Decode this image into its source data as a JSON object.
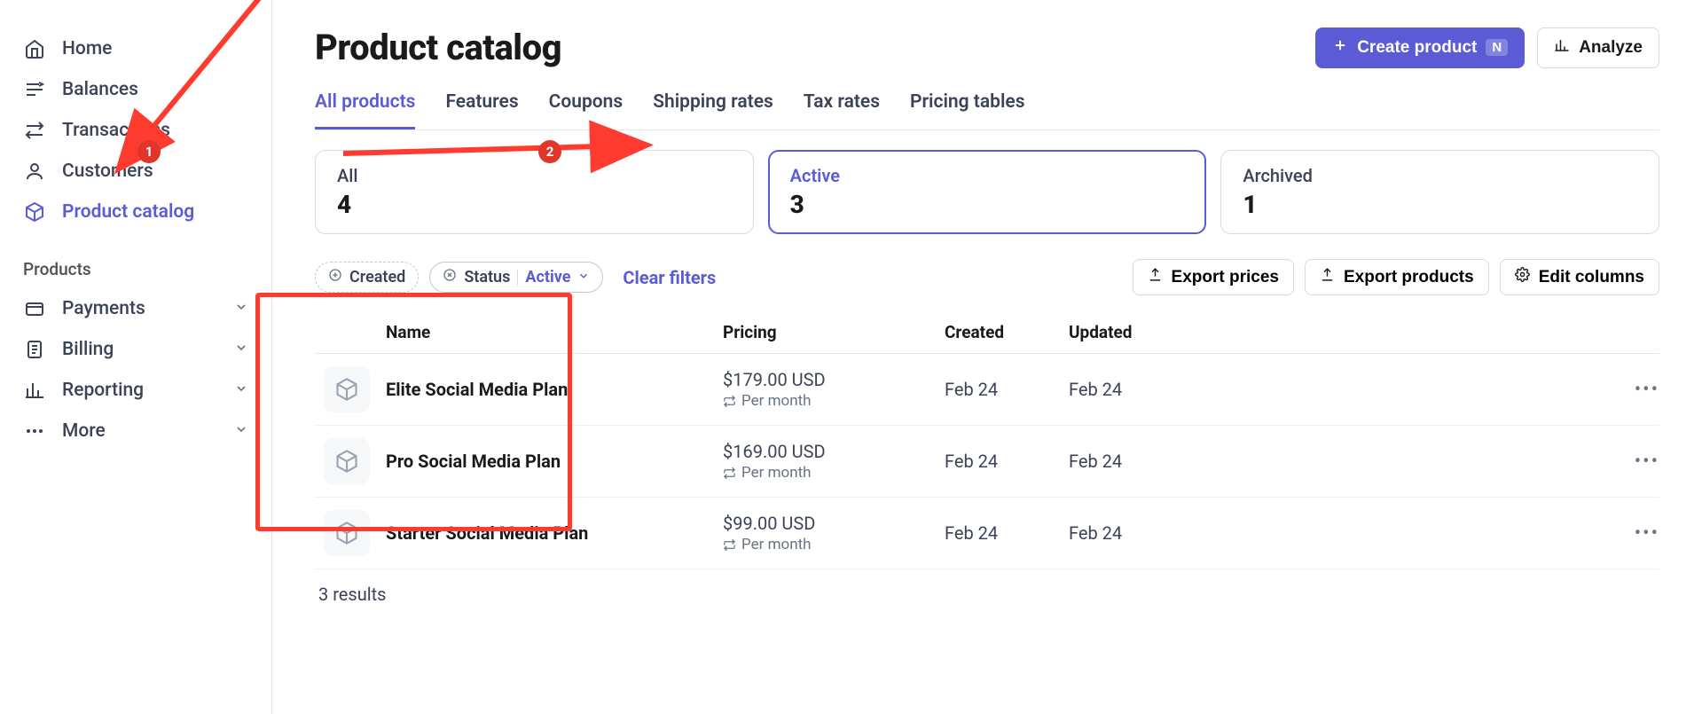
{
  "sidebar": {
    "items": [
      {
        "icon": "home",
        "label": "Home"
      },
      {
        "icon": "balances",
        "label": "Balances"
      },
      {
        "icon": "transactions",
        "label": "Transactions"
      },
      {
        "icon": "customers",
        "label": "Customers"
      },
      {
        "icon": "catalog",
        "label": "Product catalog",
        "active": true
      }
    ],
    "section_title": "Products",
    "sub_items": [
      {
        "icon": "payments",
        "label": "Payments"
      },
      {
        "icon": "billing",
        "label": "Billing"
      },
      {
        "icon": "reporting",
        "label": "Reporting"
      },
      {
        "icon": "more",
        "label": "More"
      }
    ]
  },
  "header": {
    "title": "Product catalog",
    "create_label": "Create product",
    "create_kbd": "N",
    "analyze_label": "Analyze"
  },
  "tabs": [
    {
      "label": "All products",
      "active": true
    },
    {
      "label": "Features"
    },
    {
      "label": "Coupons"
    },
    {
      "label": "Shipping rates"
    },
    {
      "label": "Tax rates"
    },
    {
      "label": "Pricing tables"
    }
  ],
  "stats": [
    {
      "label": "All",
      "value": "4"
    },
    {
      "label": "Active",
      "value": "3",
      "selected": true
    },
    {
      "label": "Archived",
      "value": "1"
    }
  ],
  "filters": {
    "created_label": "Created",
    "status_label": "Status",
    "status_value": "Active",
    "clear_label": "Clear filters",
    "export_prices": "Export prices",
    "export_products": "Export products",
    "edit_columns": "Edit columns"
  },
  "columns": {
    "name": "Name",
    "pricing": "Pricing",
    "created": "Created",
    "updated": "Updated"
  },
  "products": [
    {
      "name": "Elite Social Media Plan",
      "price": "$179.00 USD",
      "period": "Per month",
      "created": "Feb 24",
      "updated": "Feb 24"
    },
    {
      "name": "Pro Social Media Plan",
      "price": "$169.00 USD",
      "period": "Per month",
      "created": "Feb 24",
      "updated": "Feb 24"
    },
    {
      "name": "Starter Social Media Plan",
      "price": "$99.00 USD",
      "period": "Per month",
      "created": "Feb 24",
      "updated": "Feb 24"
    }
  ],
  "results_text": "3 results",
  "annotations": {
    "badge1": "1",
    "badge2": "2"
  }
}
